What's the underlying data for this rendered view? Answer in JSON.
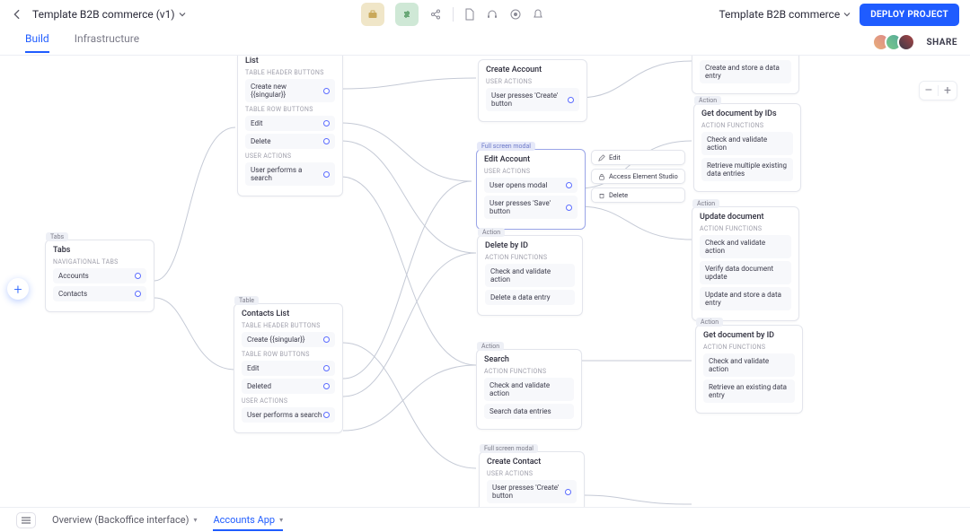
{
  "topbar": {
    "project_name": "Template B2B commerce (v1)",
    "workspace_name": "Template B2B commerce",
    "deploy_label": "DEPLOY PROJECT"
  },
  "secondbar": {
    "tab_build": "Build",
    "tab_infra": "Infrastructure",
    "share": "SHARE"
  },
  "zoom": {
    "minus": "–",
    "plus": "+"
  },
  "cards": {
    "list": {
      "title": "List",
      "sect1": "TABLE HEADER BUTTONS",
      "item1": "Create new {{singular}}",
      "sect2": "TABLE ROW BUTTONS",
      "item2": "Edit",
      "item3": "Delete",
      "sect3": "USER ACTIONS",
      "item4": "User performs a search"
    },
    "tabs": {
      "badge": "Tabs",
      "title": "Tabs",
      "sect1": "NAVIGATIONAL TABS",
      "item1": "Accounts",
      "item2": "Contacts"
    },
    "contacts": {
      "badge": "Table",
      "title": "Contacts List",
      "sect1": "TABLE HEADER BUTTONS",
      "item1": "Create {{singular}}",
      "sect2": "TABLE ROW BUTTONS",
      "item2": "Edit",
      "item3": "Deleted",
      "sect3": "USER ACTIONS",
      "item4": "User performs a search"
    },
    "createAccount": {
      "title": "Create Account",
      "sect1": "USER ACTIONS",
      "item1": "User presses 'Create' button"
    },
    "editAccount": {
      "badge": "Full screen modal",
      "title": "Edit Account",
      "sect1": "USER ACTIONS",
      "item1": "User opens modal",
      "item2": "User presses 'Save' button"
    },
    "deleteById": {
      "badge": "Action",
      "title": "Delete by ID",
      "sect1": "ACTION FUNCTIONS",
      "item1": "Check and validate action",
      "item2": "Delete a data entry"
    },
    "search": {
      "badge": "Action",
      "title": "Search",
      "sect1": "ACTION FUNCTIONS",
      "item1": "Check and validate action",
      "item2": "Search data entries"
    },
    "createContact": {
      "badge": "Full screen modal",
      "title": "Create Contact",
      "sect1": "USER ACTIONS",
      "item1": "User presses 'Create' button"
    },
    "createStore": {
      "item1": "Create and store a data entry"
    },
    "getDocIds": {
      "badge": "Action",
      "title": "Get document by IDs",
      "sect1": "ACTION FUNCTIONS",
      "item1": "Check and validate action",
      "item2": "Retrieve multiple existing data entries"
    },
    "updateDoc": {
      "badge": "Action",
      "title": "Update document",
      "sect1": "ACTION FUNCTIONS",
      "item1": "Check and validate action",
      "item2": "Verify data document update",
      "item3": "Update and store a data entry"
    },
    "getDocId": {
      "badge": "Action",
      "title": "Get document by ID",
      "sect1": "ACTION FUNCTIONS",
      "item1": "Check and validate action",
      "item2": "Retrieve an existing data entry"
    }
  },
  "float": {
    "edit": "Edit",
    "access": "Access Element Studio",
    "delete": "Delete"
  },
  "bottombar": {
    "overview": "Overview (Backoffice interface)",
    "accounts": "Accounts App"
  }
}
